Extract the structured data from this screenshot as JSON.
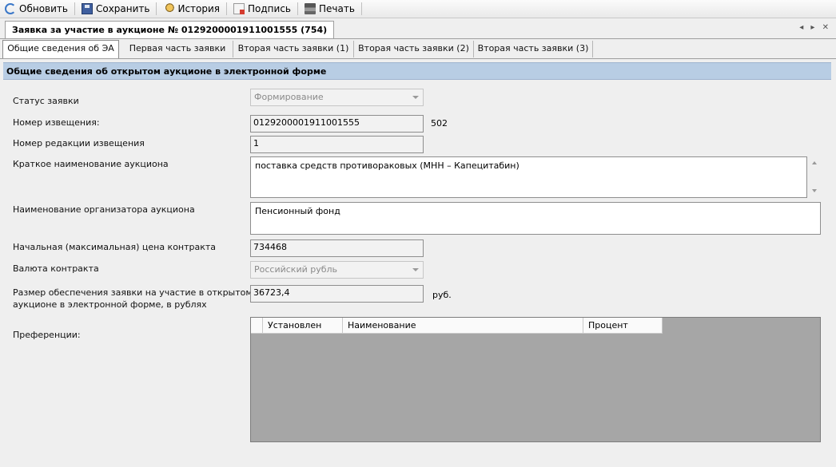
{
  "toolbar": {
    "refresh_label": "Обновить",
    "save_label": "Сохранить",
    "history_label": "История",
    "sign_label": "Подпись",
    "print_label": "Печать"
  },
  "document_tab": {
    "title": "Заявка за участие в аукционе № 0129200001911001555 (754)",
    "nav": "◂ ▸ ✕"
  },
  "subtabs": [
    {
      "label": "Общие сведения об ЭА",
      "active": true
    },
    {
      "label": "Первая часть заявки"
    },
    {
      "label": "Вторая часть заявки (1)"
    },
    {
      "label": "Вторая часть заявки (2)"
    },
    {
      "label": "Вторая часть заявки (3)"
    }
  ],
  "section": {
    "title": "Общие сведения об открытом аукционе в электронной форме"
  },
  "form": {
    "status_label": "Статус заявки",
    "status_value": "Формирование",
    "notice_number_label": "Номер извещения:",
    "notice_number_value": "0129200001911001555",
    "notice_number_suffix": "502",
    "revision_label": "Номер редакции извещения",
    "revision_value": "1",
    "short_name_label": "Краткое наименование аукциона",
    "short_name_value": "поставка средств противораковых (МНН – Капецитабин)",
    "organizer_label": "Наименование организатора аукциона",
    "organizer_value": "Пенсионный фонд",
    "price_label": "Начальная (максимальная) цена контракта",
    "price_value": "734468",
    "currency_label": "Валюта контракта",
    "currency_value": "Российский рубль",
    "security_label_line1": "Размер обеспечения заявки на участие в открытом",
    "security_label_line2": "аукционе в электронной форме, в рублях",
    "security_value": "36723,4",
    "security_unit": "руб.",
    "preferences_label": "Преференции:"
  },
  "preferences_grid": {
    "columns": [
      "Установлен",
      "Наименование",
      "Процент"
    ]
  }
}
